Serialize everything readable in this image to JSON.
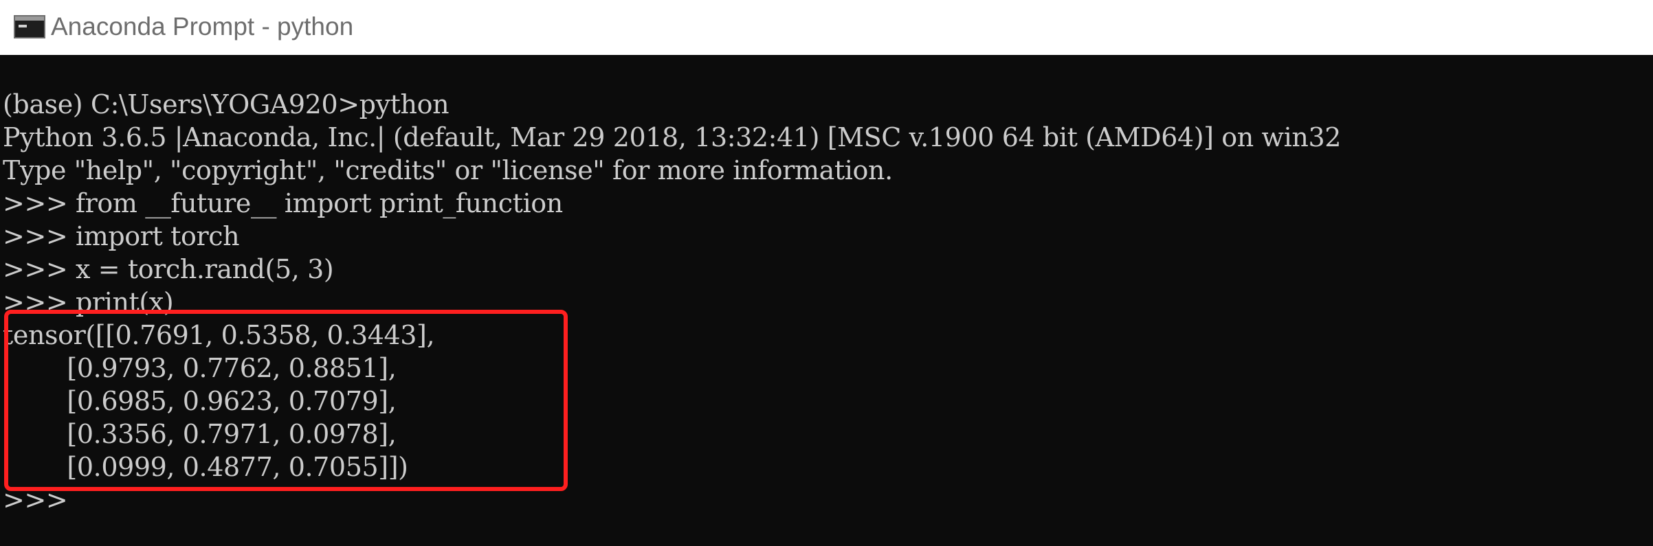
{
  "window": {
    "title": "Anaconda Prompt - python",
    "icon": "console-icon"
  },
  "console": {
    "lines": [
      "(base) C:\\Users\\YOGA920>python",
      "Python 3.6.5 |Anaconda, Inc.| (default, Mar 29 2018, 13:32:41) [MSC v.1900 64 bit (AMD64)] on win32",
      "Type \"help\", \"copyright\", \"credits\" or \"license\" for more information.",
      ">>> from __future__ import print_function",
      ">>> import torch",
      ">>> x = torch.rand(5, 3)",
      ">>> print(x)",
      "tensor([[0.7691, 0.5358, 0.3443],",
      "        [0.9793, 0.7762, 0.8851],",
      "        [0.6985, 0.9623, 0.7079],",
      "        [0.3356, 0.7971, 0.0978],",
      "        [0.0999, 0.4877, 0.7055]])",
      ">>>"
    ]
  },
  "colors": {
    "console_background": "#0c0c0c",
    "console_text": "#cccccc",
    "highlight_border": "#ff1f1f",
    "titlebar_background": "#ffffff",
    "titlebar_text": "#6d6d6d"
  }
}
